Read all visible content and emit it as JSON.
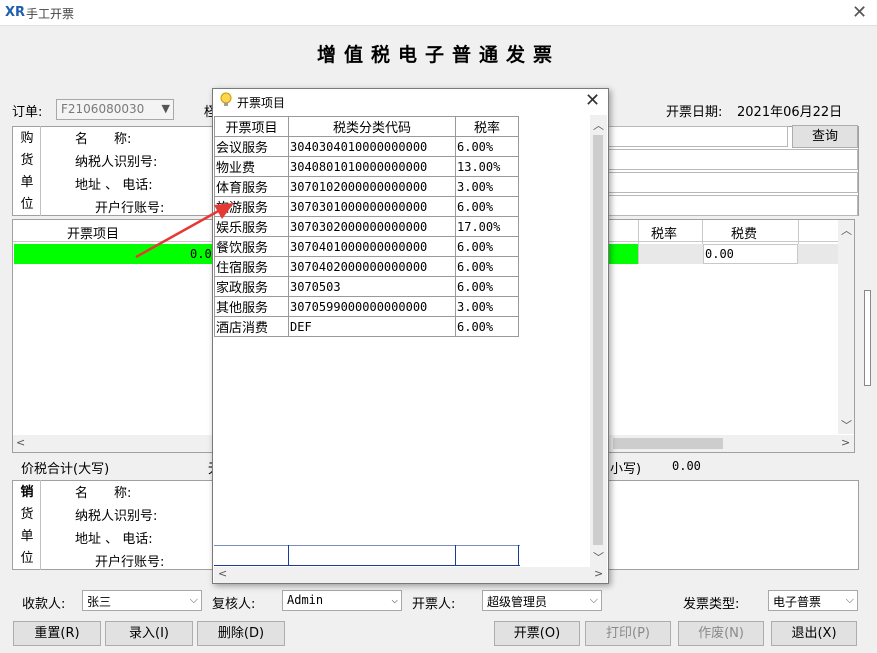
{
  "window": {
    "logo": "XR",
    "title": "手工开票"
  },
  "invoice_title": "增值税电子普通发票",
  "order": {
    "label": "订单:",
    "value": "F2106080030",
    "tax_label_partial": "柽"
  },
  "date": {
    "label": "开票日期:",
    "value": "2021年06月22日"
  },
  "query_button": "查询",
  "buyer": {
    "side_label": [
      "购",
      "货",
      "单",
      "位"
    ],
    "fields": [
      "名　　称:",
      "纳税人识别号:",
      "地址 、 电话:",
      "开户行账号:"
    ]
  },
  "grid": {
    "col_item": "开票项目",
    "col_rate": "税率",
    "col_tax": "税费",
    "row_value_partial": "0.0",
    "row_tax_value": "0.00"
  },
  "totals": {
    "upper_label": "价税合计(大写)",
    "upper_partial": "无",
    "lower_label": "小写)",
    "lower_value": "0.00"
  },
  "seller": {
    "side_label": [
      "销",
      "货",
      "单",
      "位"
    ],
    "fields": [
      "名　　称:",
      "纳税人识别号:",
      "地址 、 电话:",
      "开户行账号:"
    ]
  },
  "footer": {
    "payee_label": "收款人:",
    "payee_value": "张三",
    "reviewer_label": "复核人:",
    "reviewer_value": "Admin",
    "drawer_label": "开票人:",
    "drawer_value": "超级管理员",
    "type_label": "发票类型:",
    "type_value": "电子普票"
  },
  "buttons": {
    "reset": "重置(R)",
    "enter": "录入(I)",
    "delete": "删除(D)",
    "issue": "开票(O)",
    "print": "打印(P)",
    "void": "作废(N)",
    "exit": "退出(X)"
  },
  "dialog": {
    "title": "开票项目",
    "headers": [
      "开票项目",
      "税类分类代码",
      "税率"
    ],
    "rows": [
      [
        "会议服务",
        "3040304010000000000",
        "6.00%"
      ],
      [
        "物业费",
        "3040801010000000000",
        "13.00%"
      ],
      [
        "体育服务",
        "3070102000000000000",
        "3.00%"
      ],
      [
        "旅游服务",
        "3070301000000000000",
        "6.00%"
      ],
      [
        "娱乐服务",
        "3070302000000000000",
        "17.00%"
      ],
      [
        "餐饮服务",
        "3070401000000000000",
        "6.00%"
      ],
      [
        "住宿服务",
        "3070402000000000000",
        "6.00%"
      ],
      [
        "家政服务",
        "3070503",
        "6.00%"
      ],
      [
        "其他服务",
        "3070599000000000000",
        "3.00%"
      ],
      [
        "酒店消费",
        "DEF",
        "6.00%"
      ]
    ]
  },
  "colors": {
    "selected_row": "#00ff00",
    "arrow": "#e53935",
    "logo": "#1f5fb0"
  }
}
